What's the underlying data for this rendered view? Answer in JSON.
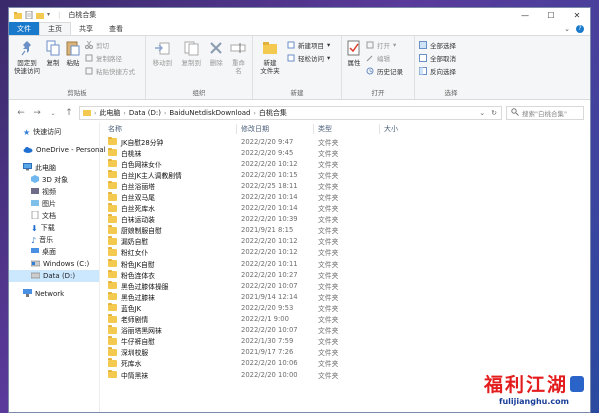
{
  "window": {
    "title": "白桃合集"
  },
  "tabs": {
    "file": "文件",
    "home": "主页",
    "share": "共享",
    "view": "查看"
  },
  "ribbon": {
    "clipboard": {
      "label": "剪贴板",
      "pin": "固定到\n快速访问",
      "copy": "复制",
      "paste": "粘贴",
      "cut": "剪切",
      "copy_path": "复制路径",
      "paste_shortcut": "粘贴快捷方式"
    },
    "organize": {
      "label": "组织",
      "move_to": "移动到",
      "copy_to": "复制到",
      "delete": "删除",
      "rename": "重命名"
    },
    "new": {
      "label": "新建",
      "new_folder": "新建\n文件夹",
      "new_item": "新建项目",
      "easy_access": "轻松访问"
    },
    "open": {
      "label": "打开",
      "properties": "属性",
      "open": "打开",
      "edit": "编辑",
      "history": "历史记录"
    },
    "select": {
      "label": "选择",
      "select_all": "全部选择",
      "select_none": "全部取消",
      "invert": "反向选择"
    }
  },
  "address": {
    "crumbs": [
      "此电脑",
      "Data (D:)",
      "BaiduNetdiskDownload",
      "白桃合集"
    ],
    "search_placeholder": "搜索\"白桃合集\""
  },
  "nav": {
    "quick_access": "快速访问",
    "onedrive": "OneDrive - Personal",
    "this_pc": "此电脑",
    "objects3d": "3D 对象",
    "videos": "视频",
    "pictures": "图片",
    "documents": "文档",
    "downloads": "下载",
    "music": "音乐",
    "desktop": "桌面",
    "windows_c": "Windows (C:)",
    "data_d": "Data (D:)",
    "network": "Network"
  },
  "columns": {
    "name": "名称",
    "date": "修改日期",
    "type": "类型",
    "size": "大小"
  },
  "files": [
    {
      "name": "JK自慰28分钟",
      "date": "2022/2/20 9:47",
      "type": "文件夹"
    },
    {
      "name": "白桃袜",
      "date": "2022/2/20 9:45",
      "type": "文件夹"
    },
    {
      "name": "白色网袜女仆",
      "date": "2022/2/20 10:12",
      "type": "文件夹"
    },
    {
      "name": "白丝JK主人调教剧情",
      "date": "2022/2/20 10:15",
      "type": "文件夹"
    },
    {
      "name": "白丝浴丽塔",
      "date": "2022/2/25 18:11",
      "type": "文件夹"
    },
    {
      "name": "白丝双马尾",
      "date": "2022/2/20 10:14",
      "type": "文件夹"
    },
    {
      "name": "白丝死库水",
      "date": "2022/2/20 10:14",
      "type": "文件夹"
    },
    {
      "name": "白袜运动装",
      "date": "2022/2/20 10:39",
      "type": "文件夹"
    },
    {
      "name": "厨娘制服自慰",
      "date": "2021/9/21 8:15",
      "type": "文件夹"
    },
    {
      "name": "漏奶自慰",
      "date": "2022/2/20 10:12",
      "type": "文件夹"
    },
    {
      "name": "粉红女仆",
      "date": "2022/2/20 10:12",
      "type": "文件夹"
    },
    {
      "name": "粉色JK自慰",
      "date": "2022/2/20 10:11",
      "type": "文件夹"
    },
    {
      "name": "粉色连体衣",
      "date": "2022/2/20 10:27",
      "type": "文件夹"
    },
    {
      "name": "黑色过膝体操服",
      "date": "2022/2/20 10:07",
      "type": "文件夹"
    },
    {
      "name": "黑色过膝袜",
      "date": "2021/9/14 12:14",
      "type": "文件夹"
    },
    {
      "name": "蓝色JK",
      "date": "2022/2/20 9:53",
      "type": "文件夹"
    },
    {
      "name": "老师剧情",
      "date": "2022/2/1 9:00",
      "type": "文件夹"
    },
    {
      "name": "浴丽塔黑网袜",
      "date": "2022/2/20 10:07",
      "type": "文件夹"
    },
    {
      "name": "牛仔裤自慰",
      "date": "2022/1/30 7:59",
      "type": "文件夹"
    },
    {
      "name": "深圳校服",
      "date": "2021/9/17 7:26",
      "type": "文件夹"
    },
    {
      "name": "死库水",
      "date": "2022/2/20 10:06",
      "type": "文件夹"
    },
    {
      "name": "中筒黑袜",
      "date": "2022/2/20 10:00",
      "type": "文件夹"
    }
  ],
  "watermark": {
    "brand": "福利江湖",
    "url": "fulijianghu.com"
  }
}
